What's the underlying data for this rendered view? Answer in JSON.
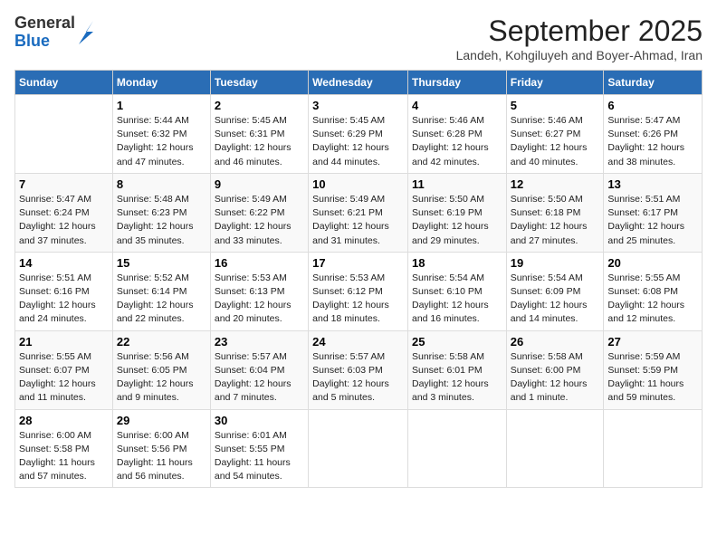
{
  "logo": {
    "general": "General",
    "blue": "Blue"
  },
  "title": "September 2025",
  "subtitle": "Landeh, Kohgiluyeh and Boyer-Ahmad, Iran",
  "columns": [
    "Sunday",
    "Monday",
    "Tuesday",
    "Wednesday",
    "Thursday",
    "Friday",
    "Saturday"
  ],
  "weeks": [
    [
      {
        "day": "",
        "info": ""
      },
      {
        "day": "1",
        "info": "Sunrise: 5:44 AM\nSunset: 6:32 PM\nDaylight: 12 hours\nand 47 minutes."
      },
      {
        "day": "2",
        "info": "Sunrise: 5:45 AM\nSunset: 6:31 PM\nDaylight: 12 hours\nand 46 minutes."
      },
      {
        "day": "3",
        "info": "Sunrise: 5:45 AM\nSunset: 6:29 PM\nDaylight: 12 hours\nand 44 minutes."
      },
      {
        "day": "4",
        "info": "Sunrise: 5:46 AM\nSunset: 6:28 PM\nDaylight: 12 hours\nand 42 minutes."
      },
      {
        "day": "5",
        "info": "Sunrise: 5:46 AM\nSunset: 6:27 PM\nDaylight: 12 hours\nand 40 minutes."
      },
      {
        "day": "6",
        "info": "Sunrise: 5:47 AM\nSunset: 6:26 PM\nDaylight: 12 hours\nand 38 minutes."
      }
    ],
    [
      {
        "day": "7",
        "info": "Sunrise: 5:47 AM\nSunset: 6:24 PM\nDaylight: 12 hours\nand 37 minutes."
      },
      {
        "day": "8",
        "info": "Sunrise: 5:48 AM\nSunset: 6:23 PM\nDaylight: 12 hours\nand 35 minutes."
      },
      {
        "day": "9",
        "info": "Sunrise: 5:49 AM\nSunset: 6:22 PM\nDaylight: 12 hours\nand 33 minutes."
      },
      {
        "day": "10",
        "info": "Sunrise: 5:49 AM\nSunset: 6:21 PM\nDaylight: 12 hours\nand 31 minutes."
      },
      {
        "day": "11",
        "info": "Sunrise: 5:50 AM\nSunset: 6:19 PM\nDaylight: 12 hours\nand 29 minutes."
      },
      {
        "day": "12",
        "info": "Sunrise: 5:50 AM\nSunset: 6:18 PM\nDaylight: 12 hours\nand 27 minutes."
      },
      {
        "day": "13",
        "info": "Sunrise: 5:51 AM\nSunset: 6:17 PM\nDaylight: 12 hours\nand 25 minutes."
      }
    ],
    [
      {
        "day": "14",
        "info": "Sunrise: 5:51 AM\nSunset: 6:16 PM\nDaylight: 12 hours\nand 24 minutes."
      },
      {
        "day": "15",
        "info": "Sunrise: 5:52 AM\nSunset: 6:14 PM\nDaylight: 12 hours\nand 22 minutes."
      },
      {
        "day": "16",
        "info": "Sunrise: 5:53 AM\nSunset: 6:13 PM\nDaylight: 12 hours\nand 20 minutes."
      },
      {
        "day": "17",
        "info": "Sunrise: 5:53 AM\nSunset: 6:12 PM\nDaylight: 12 hours\nand 18 minutes."
      },
      {
        "day": "18",
        "info": "Sunrise: 5:54 AM\nSunset: 6:10 PM\nDaylight: 12 hours\nand 16 minutes."
      },
      {
        "day": "19",
        "info": "Sunrise: 5:54 AM\nSunset: 6:09 PM\nDaylight: 12 hours\nand 14 minutes."
      },
      {
        "day": "20",
        "info": "Sunrise: 5:55 AM\nSunset: 6:08 PM\nDaylight: 12 hours\nand 12 minutes."
      }
    ],
    [
      {
        "day": "21",
        "info": "Sunrise: 5:55 AM\nSunset: 6:07 PM\nDaylight: 12 hours\nand 11 minutes."
      },
      {
        "day": "22",
        "info": "Sunrise: 5:56 AM\nSunset: 6:05 PM\nDaylight: 12 hours\nand 9 minutes."
      },
      {
        "day": "23",
        "info": "Sunrise: 5:57 AM\nSunset: 6:04 PM\nDaylight: 12 hours\nand 7 minutes."
      },
      {
        "day": "24",
        "info": "Sunrise: 5:57 AM\nSunset: 6:03 PM\nDaylight: 12 hours\nand 5 minutes."
      },
      {
        "day": "25",
        "info": "Sunrise: 5:58 AM\nSunset: 6:01 PM\nDaylight: 12 hours\nand 3 minutes."
      },
      {
        "day": "26",
        "info": "Sunrise: 5:58 AM\nSunset: 6:00 PM\nDaylight: 12 hours\nand 1 minute."
      },
      {
        "day": "27",
        "info": "Sunrise: 5:59 AM\nSunset: 5:59 PM\nDaylight: 11 hours\nand 59 minutes."
      }
    ],
    [
      {
        "day": "28",
        "info": "Sunrise: 6:00 AM\nSunset: 5:58 PM\nDaylight: 11 hours\nand 57 minutes."
      },
      {
        "day": "29",
        "info": "Sunrise: 6:00 AM\nSunset: 5:56 PM\nDaylight: 11 hours\nand 56 minutes."
      },
      {
        "day": "30",
        "info": "Sunrise: 6:01 AM\nSunset: 5:55 PM\nDaylight: 11 hours\nand 54 minutes."
      },
      {
        "day": "",
        "info": ""
      },
      {
        "day": "",
        "info": ""
      },
      {
        "day": "",
        "info": ""
      },
      {
        "day": "",
        "info": ""
      }
    ]
  ]
}
